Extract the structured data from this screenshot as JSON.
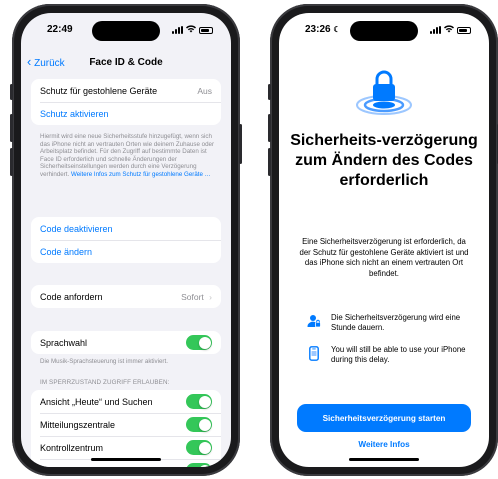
{
  "left": {
    "status": {
      "time": "22:49"
    },
    "nav": {
      "back": "Zurück",
      "title": "Face ID & Code"
    },
    "stolen": {
      "label": "Schutz für gestohlene Geräte",
      "value": "Aus",
      "activate": "Schutz aktivieren"
    },
    "footnote": {
      "text": "Hiermit wird eine neue Sicherheitsstufe hinzugefügt, wenn sich das iPhone nicht an vertrauten Orten wie deinem Zuhause oder Arbeitsplatz befindet. Für den Zugriff auf bestimmte Daten ist Face ID erforderlich und schnelle Änderungen der Sicherheitseinstellungen werden durch eine Verzögerung verhindert.",
      "link": "Weitere Infos zum Schutz für gestohlene Geräte …"
    },
    "code": {
      "deactivate": "Code deaktivieren",
      "change": "Code ändern"
    },
    "require": {
      "label": "Code anfordern",
      "value": "Sofort",
      "chevron": "›"
    },
    "voice": {
      "label": "Sprachwahl",
      "on": true,
      "note": "Die Musik-Sprachsteuerung ist immer aktiviert."
    },
    "locked": {
      "header": "IM SPERRZUSTAND ZUGRIFF ERLAUBEN:",
      "items": [
        {
          "label": "Ansicht „Heute“ und Suchen",
          "on": true
        },
        {
          "label": "Mitteilungszentrale",
          "on": true
        },
        {
          "label": "Kontrollzentrum",
          "on": true
        }
      ]
    }
  },
  "right": {
    "status": {
      "time": "23:26"
    },
    "title": "Sicherheits-verzögerung zum Ändern des Codes erforderlich",
    "body": "Eine Sicherheitsverzögerung ist erforderlich, da der Schutz für gestohlene Geräte aktiviert ist und das iPhone sich nicht an einem vertrauten Ort befindet.",
    "features": [
      {
        "icon": "person-lock-icon",
        "text": "Die Sicherheitsverzögerung wird eine Stunde dauern."
      },
      {
        "icon": "phone-icon",
        "text": "You will still be able to use your iPhone during this delay."
      }
    ],
    "primary_button": "Sicherheitsverzögerung starten",
    "secondary_link": "Weitere Infos"
  },
  "colors": {
    "accent": "#007aff",
    "toggle_on": "#34c759",
    "grouped_bg": "#f2f2f7"
  }
}
